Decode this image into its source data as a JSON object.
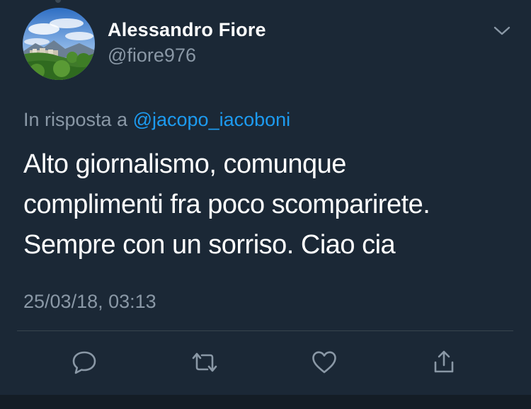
{
  "author": {
    "display_name": "Alessandro Fiore",
    "handle": "@fiore976",
    "avatar": "landscape-photo"
  },
  "reply_to": {
    "prefix": "In risposta a",
    "mention": "@jacopo_iacoboni"
  },
  "tweet": {
    "lines": [
      "Alto giornalismo, comunque",
      "complimenti fra poco scomparirete.",
      "Sempre con un sorriso. Ciao cia"
    ],
    "timestamp": "25/03/18, 03:13"
  },
  "actions": [
    {
      "name": "reply",
      "icon": "speech-bubble-icon"
    },
    {
      "name": "retweet",
      "icon": "retweet-arrows-icon"
    },
    {
      "name": "like",
      "icon": "heart-icon"
    },
    {
      "name": "share",
      "icon": "share-upload-icon"
    }
  ],
  "colors": {
    "background": "#1b2836",
    "text": "#ffffff",
    "secondary_text": "#8a98a6",
    "link": "#1d9bf0",
    "divider": "#38444d"
  }
}
